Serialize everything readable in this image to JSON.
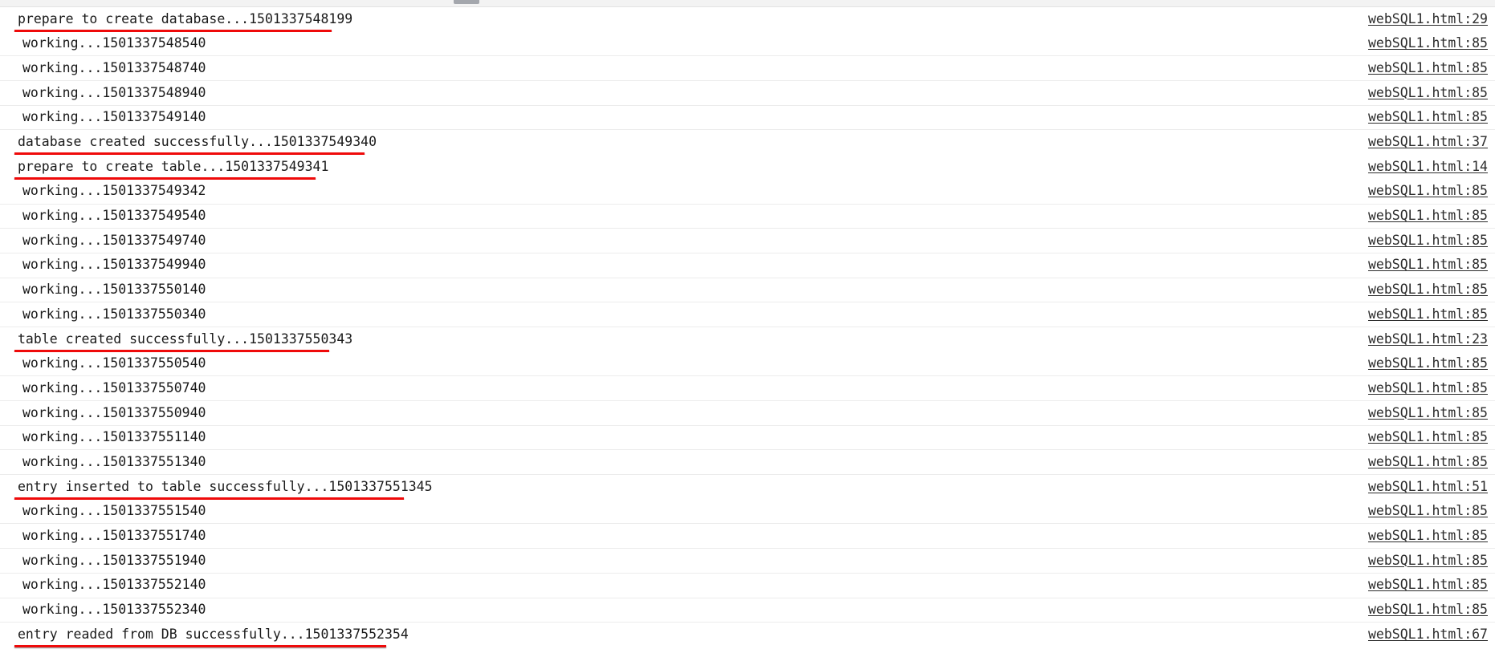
{
  "window": {
    "top_strip_handle": "drag-handle",
    "accent_annotation_color": "#ef0a0a",
    "row_separator_color": "#ececec",
    "text_color": "#1a1a1a",
    "link_color": "#2b2b2b"
  },
  "console": {
    "source_file": "webSQL1.html",
    "rows": [
      {
        "message": "prepare to create database...1501337548199",
        "source": "webSQL1.html:29",
        "indent": false,
        "annotated": true,
        "rule": "w1"
      },
      {
        "message": "working...1501337548540",
        "source": "webSQL1.html:85",
        "indent": true,
        "annotated": false,
        "rule": ""
      },
      {
        "message": "working...1501337548740",
        "source": "webSQL1.html:85",
        "indent": true,
        "annotated": false,
        "rule": ""
      },
      {
        "message": "working...1501337548940",
        "source": "webSQL1.html:85",
        "indent": true,
        "annotated": false,
        "rule": ""
      },
      {
        "message": "working...1501337549140",
        "source": "webSQL1.html:85",
        "indent": true,
        "annotated": false,
        "rule": ""
      },
      {
        "message": "database created successfully...1501337549340",
        "source": "webSQL1.html:37",
        "indent": false,
        "annotated": true,
        "rule": "w2"
      },
      {
        "message": "prepare to create table...1501337549341",
        "source": "webSQL1.html:14",
        "indent": false,
        "annotated": true,
        "rule": "w3"
      },
      {
        "message": "working...1501337549342",
        "source": "webSQL1.html:85",
        "indent": true,
        "annotated": false,
        "rule": ""
      },
      {
        "message": "working...1501337549540",
        "source": "webSQL1.html:85",
        "indent": true,
        "annotated": false,
        "rule": ""
      },
      {
        "message": "working...1501337549740",
        "source": "webSQL1.html:85",
        "indent": true,
        "annotated": false,
        "rule": ""
      },
      {
        "message": "working...1501337549940",
        "source": "webSQL1.html:85",
        "indent": true,
        "annotated": false,
        "rule": ""
      },
      {
        "message": "working...1501337550140",
        "source": "webSQL1.html:85",
        "indent": true,
        "annotated": false,
        "rule": ""
      },
      {
        "message": "working...1501337550340",
        "source": "webSQL1.html:85",
        "indent": true,
        "annotated": false,
        "rule": ""
      },
      {
        "message": "table created successfully...1501337550343",
        "source": "webSQL1.html:23",
        "indent": false,
        "annotated": true,
        "rule": "w4"
      },
      {
        "message": "working...1501337550540",
        "source": "webSQL1.html:85",
        "indent": true,
        "annotated": false,
        "rule": ""
      },
      {
        "message": "working...1501337550740",
        "source": "webSQL1.html:85",
        "indent": true,
        "annotated": false,
        "rule": ""
      },
      {
        "message": "working...1501337550940",
        "source": "webSQL1.html:85",
        "indent": true,
        "annotated": false,
        "rule": ""
      },
      {
        "message": "working...1501337551140",
        "source": "webSQL1.html:85",
        "indent": true,
        "annotated": false,
        "rule": ""
      },
      {
        "message": "working...1501337551340",
        "source": "webSQL1.html:85",
        "indent": true,
        "annotated": false,
        "rule": ""
      },
      {
        "message": "entry inserted to table successfully...1501337551345",
        "source": "webSQL1.html:51",
        "indent": false,
        "annotated": true,
        "rule": "w5"
      },
      {
        "message": "working...1501337551540",
        "source": "webSQL1.html:85",
        "indent": true,
        "annotated": false,
        "rule": ""
      },
      {
        "message": "working...1501337551740",
        "source": "webSQL1.html:85",
        "indent": true,
        "annotated": false,
        "rule": ""
      },
      {
        "message": "working...1501337551940",
        "source": "webSQL1.html:85",
        "indent": true,
        "annotated": false,
        "rule": ""
      },
      {
        "message": "working...1501337552140",
        "source": "webSQL1.html:85",
        "indent": true,
        "annotated": false,
        "rule": ""
      },
      {
        "message": "working...1501337552340",
        "source": "webSQL1.html:85",
        "indent": true,
        "annotated": false,
        "rule": ""
      },
      {
        "message": "entry readed from DB successfully...1501337552354",
        "source": "webSQL1.html:67",
        "indent": false,
        "annotated": true,
        "rule": "w6"
      }
    ]
  }
}
